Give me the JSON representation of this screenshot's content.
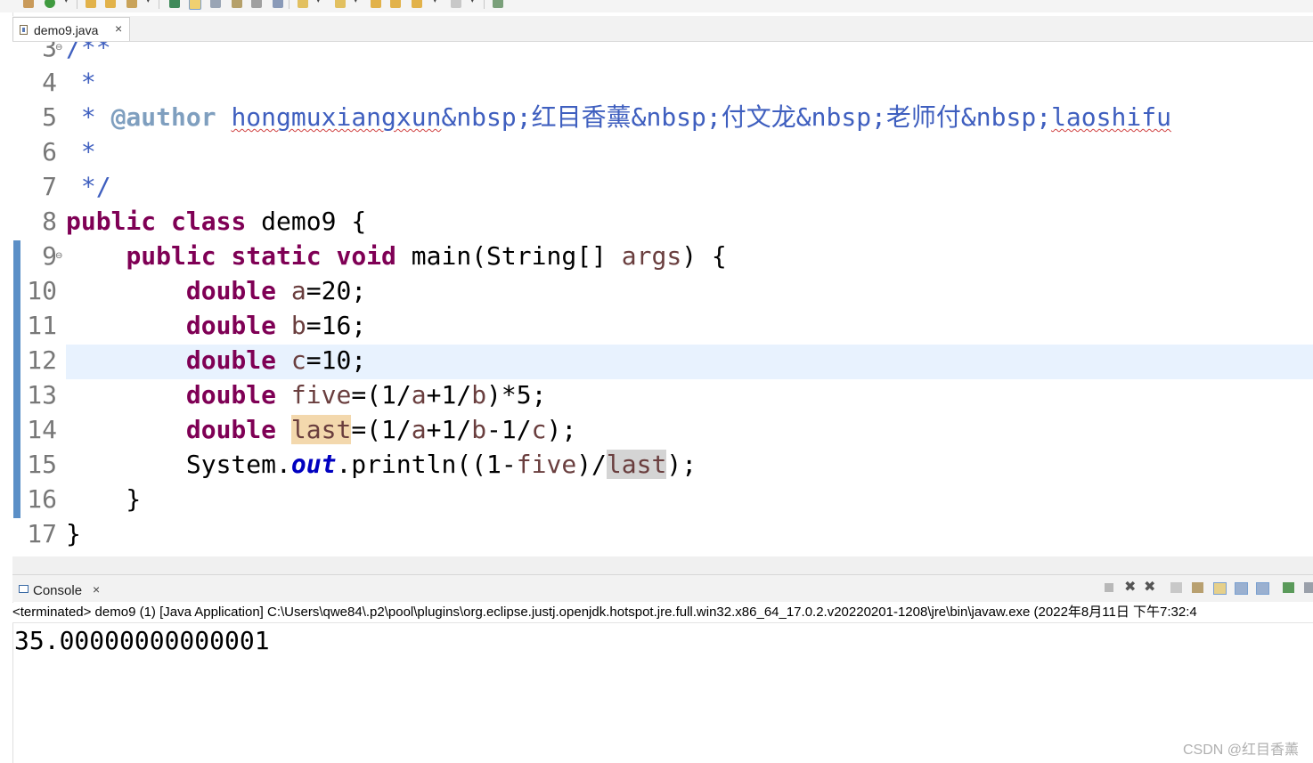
{
  "editor_tab": {
    "label": "demo9.java",
    "close": "×"
  },
  "code": {
    "line_numbers": [
      "3",
      "4",
      "5",
      "6",
      "7",
      "8",
      "9",
      "10",
      "11",
      "12",
      "13",
      "14",
      "15",
      "16",
      "17"
    ],
    "lines": [
      [
        {
          "t": "/**",
          "c": "cm"
        }
      ],
      [
        {
          "t": " *",
          "c": "cm"
        }
      ],
      [
        {
          "t": " * ",
          "c": "cm"
        },
        {
          "t": "@author",
          "c": "tag"
        },
        {
          "t": " ",
          "c": "cm"
        },
        {
          "t": "hongmuxiangxun",
          "c": "cm sq"
        },
        {
          "t": "&nbsp;红目香薰&nbsp;付文龙&nbsp;老师付&nbsp;",
          "c": "cm"
        },
        {
          "t": "laoshifu",
          "c": "cm sq"
        }
      ],
      [
        {
          "t": " *",
          "c": "cm"
        }
      ],
      [
        {
          "t": " */",
          "c": "cm"
        }
      ],
      [
        {
          "t": "public",
          "c": "kw"
        },
        {
          "t": " "
        },
        {
          "t": "class",
          "c": "kw"
        },
        {
          "t": " demo9 {"
        }
      ],
      [
        {
          "t": "    "
        },
        {
          "t": "public",
          "c": "kw"
        },
        {
          "t": " "
        },
        {
          "t": "static",
          "c": "kw"
        },
        {
          "t": " "
        },
        {
          "t": "void",
          "c": "kw"
        },
        {
          "t": " main(String[] "
        },
        {
          "t": "args",
          "c": "var"
        },
        {
          "t": ") {"
        }
      ],
      [
        {
          "t": "        "
        },
        {
          "t": "double",
          "c": "kw"
        },
        {
          "t": " "
        },
        {
          "t": "a",
          "c": "var"
        },
        {
          "t": "=20;"
        }
      ],
      [
        {
          "t": "        "
        },
        {
          "t": "double",
          "c": "kw"
        },
        {
          "t": " "
        },
        {
          "t": "b",
          "c": "var"
        },
        {
          "t": "=16;"
        }
      ],
      [
        {
          "t": "        "
        },
        {
          "t": "double",
          "c": "kw"
        },
        {
          "t": " "
        },
        {
          "t": "c",
          "c": "var"
        },
        {
          "t": "=10;"
        }
      ],
      [
        {
          "t": "        "
        },
        {
          "t": "double",
          "c": "kw"
        },
        {
          "t": " "
        },
        {
          "t": "five",
          "c": "var"
        },
        {
          "t": "=(1/"
        },
        {
          "t": "a",
          "c": "var"
        },
        {
          "t": "+1/"
        },
        {
          "t": "b",
          "c": "var"
        },
        {
          "t": ")*5;"
        }
      ],
      [
        {
          "t": "        "
        },
        {
          "t": "double",
          "c": "kw"
        },
        {
          "t": " "
        },
        {
          "t": "last",
          "c": "var hl-write"
        },
        {
          "t": "=(1/"
        },
        {
          "t": "a",
          "c": "var"
        },
        {
          "t": "+1/"
        },
        {
          "t": "b",
          "c": "var"
        },
        {
          "t": "-1/"
        },
        {
          "t": "c",
          "c": "var"
        },
        {
          "t": ");"
        }
      ],
      [
        {
          "t": "        System."
        },
        {
          "t": "out",
          "c": "fld"
        },
        {
          "t": ".println((1-"
        },
        {
          "t": "five",
          "c": "var"
        },
        {
          "t": ")/"
        },
        {
          "t": "last",
          "c": "var hl-read"
        },
        {
          "t": ");"
        }
      ],
      [
        {
          "t": "    }"
        }
      ],
      [
        {
          "t": "}"
        }
      ]
    ]
  },
  "console": {
    "tab_label": "Console",
    "close": "×",
    "status": "<terminated> demo9 (1) [Java Application] C:\\Users\\qwe84\\.p2\\pool\\plugins\\org.eclipse.justj.openjdk.hotspot.jre.full.win32.x86_64_17.0.2.v20220201-1208\\jre\\bin\\javaw.exe  (2022年8月11日 下午7:32:4",
    "output": "35.00000000000001"
  },
  "watermark": "CSDN @红目香薰",
  "colors": {
    "keyword": "#7f0055",
    "comment": "#3f5fbf",
    "javadoc_tag": "#7f9fbf",
    "local_var": "#6a3e3e",
    "static_field": "#0000c0",
    "current_line": "#e8f2fe",
    "change_bar": "#5b8fc7"
  }
}
